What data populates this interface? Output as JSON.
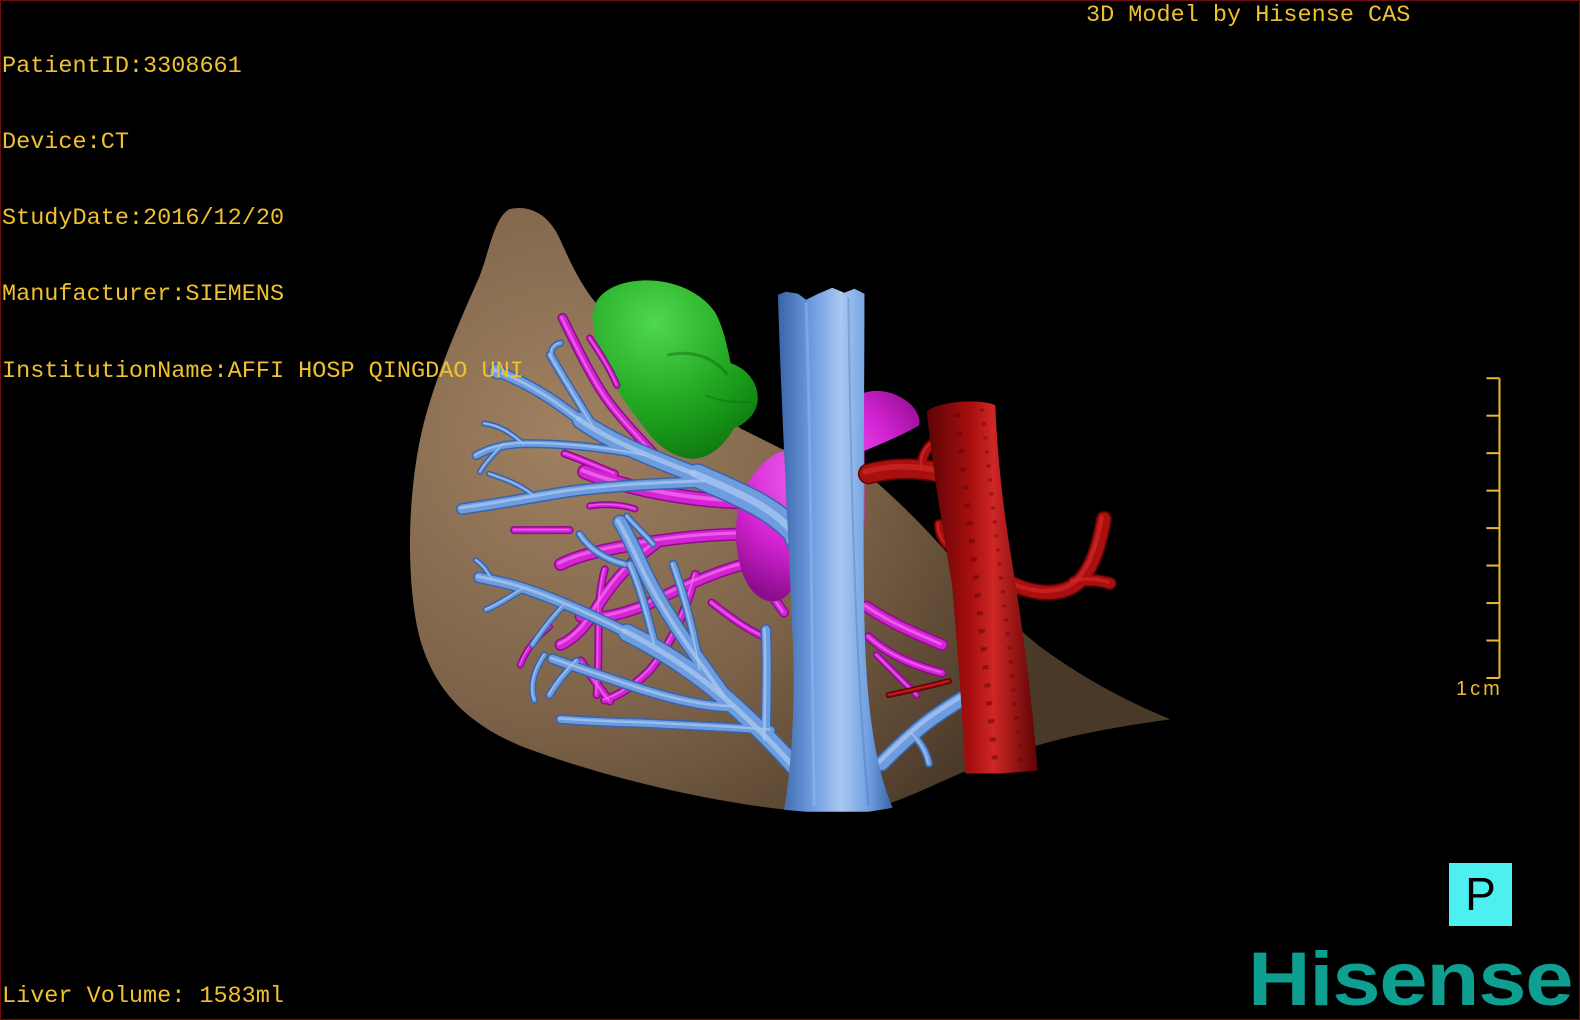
{
  "viewer": {
    "patient_info": [
      {
        "label": "PatientID:",
        "value": "3308661"
      },
      {
        "label": "Device:",
        "value": "CT"
      },
      {
        "label": "StudyDate:",
        "value": "2016/12/20"
      },
      {
        "label": "Manufacturer:",
        "value": "SIEMENS"
      },
      {
        "label": "InstitutionName:",
        "value": "AFFI HOSP QINGDAO UNI"
      }
    ],
    "model_credit": "3D Model by Hisense CAS",
    "liver_volume": {
      "label": "Liver Volume:",
      "value": "1583ml"
    },
    "scale_bar": {
      "label": "1cm"
    },
    "orientation_marker": {
      "label": "P"
    },
    "brand_logo": {
      "text": "Hisense"
    }
  },
  "theme_colors": {
    "bg": "#000000",
    "frame": "#6b0f12",
    "overlay-text": "#EFC12F",
    "scale-bar": "#E9B931",
    "marker-bg": "#4EEFF0",
    "marker-fg": "#000000",
    "brand": "#0E9F91",
    "liver-light": "#a08161",
    "liver-mid": "#7c6248",
    "liver-dark": "#4a3928",
    "gallbladder-light": "#4fd94f",
    "gallbladder-mid": "#1c9f1c",
    "gallbladder-dark": "#0a6a0a",
    "hepatic-light": "#a9c8f2",
    "hepatic-mid": "#6e9ddf",
    "hepatic-dark": "#3a63a8",
    "portal-light": "#f26ef2",
    "portal-mid": "#d424d4",
    "portal-dark": "#8c0c8c",
    "aorta-light": "#cf2626",
    "aorta-mid": "#a80f0f",
    "aorta-dark": "#5c0404"
  }
}
